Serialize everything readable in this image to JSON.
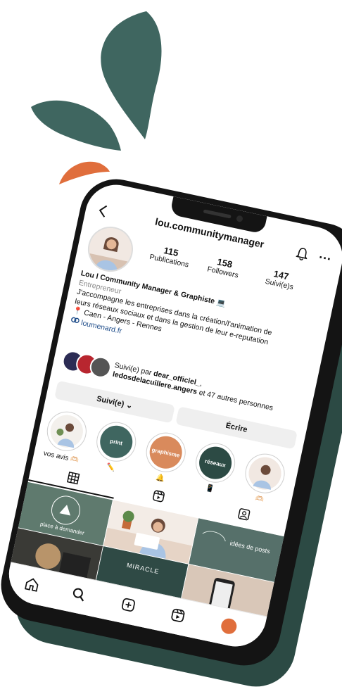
{
  "colors": {
    "teal": "#3f6660",
    "orange": "#e06e3c",
    "dark_green": "#2c4a44",
    "link": "#1f4d8a",
    "grey_text": "#8a8a8a",
    "button_bg": "#efefef"
  },
  "header": {
    "back_icon": "chevron-left-icon",
    "username": "lou.communitymanager",
    "bell_icon": "bell-icon",
    "more_label": "···"
  },
  "stats": [
    {
      "value": "115",
      "label": "Publications"
    },
    {
      "value": "158",
      "label": "Followers"
    },
    {
      "value": "147",
      "label": "Suivi(e)s"
    }
  ],
  "bio": {
    "name": "Lou l Community Manager & Graphiste 💻",
    "category": "Entrepreneur",
    "line1": "J'accompagne les entreprises dans la création/l'animation de",
    "line2": "leurs réseaux sociaux et dans la gestion de leur e-reputation",
    "location": "📍 Caen - Angers - Rennes",
    "link": "loumenard.fr"
  },
  "followed": {
    "prefix": "Suivi(e) par ",
    "user1": "dear_officiel_",
    "sep": ",",
    "user2": "ledosdelacuillere.angers",
    "suffix": " et 47 autres personnes"
  },
  "buttons": {
    "follow": "Suivi(e) ⌄",
    "message": "Écrire"
  },
  "highlights": [
    {
      "label": "vos avis 🫶🏻",
      "inner": ""
    },
    {
      "label": "✏️",
      "inner": "print"
    },
    {
      "label": "🔔",
      "inner": "graphisme"
    },
    {
      "label": "📱",
      "inner": "réseaux"
    },
    {
      "label": "🫶🏻",
      "inner": ""
    }
  ],
  "grid_texts": {
    "post1": "place à demander",
    "post2": "MIRACLE",
    "post3": "idées de posts"
  },
  "nav": {
    "home": "home-icon",
    "search": "search-icon",
    "create": "plus-square-icon",
    "reels": "reels-icon",
    "profile": "profile-avatar-icon"
  }
}
